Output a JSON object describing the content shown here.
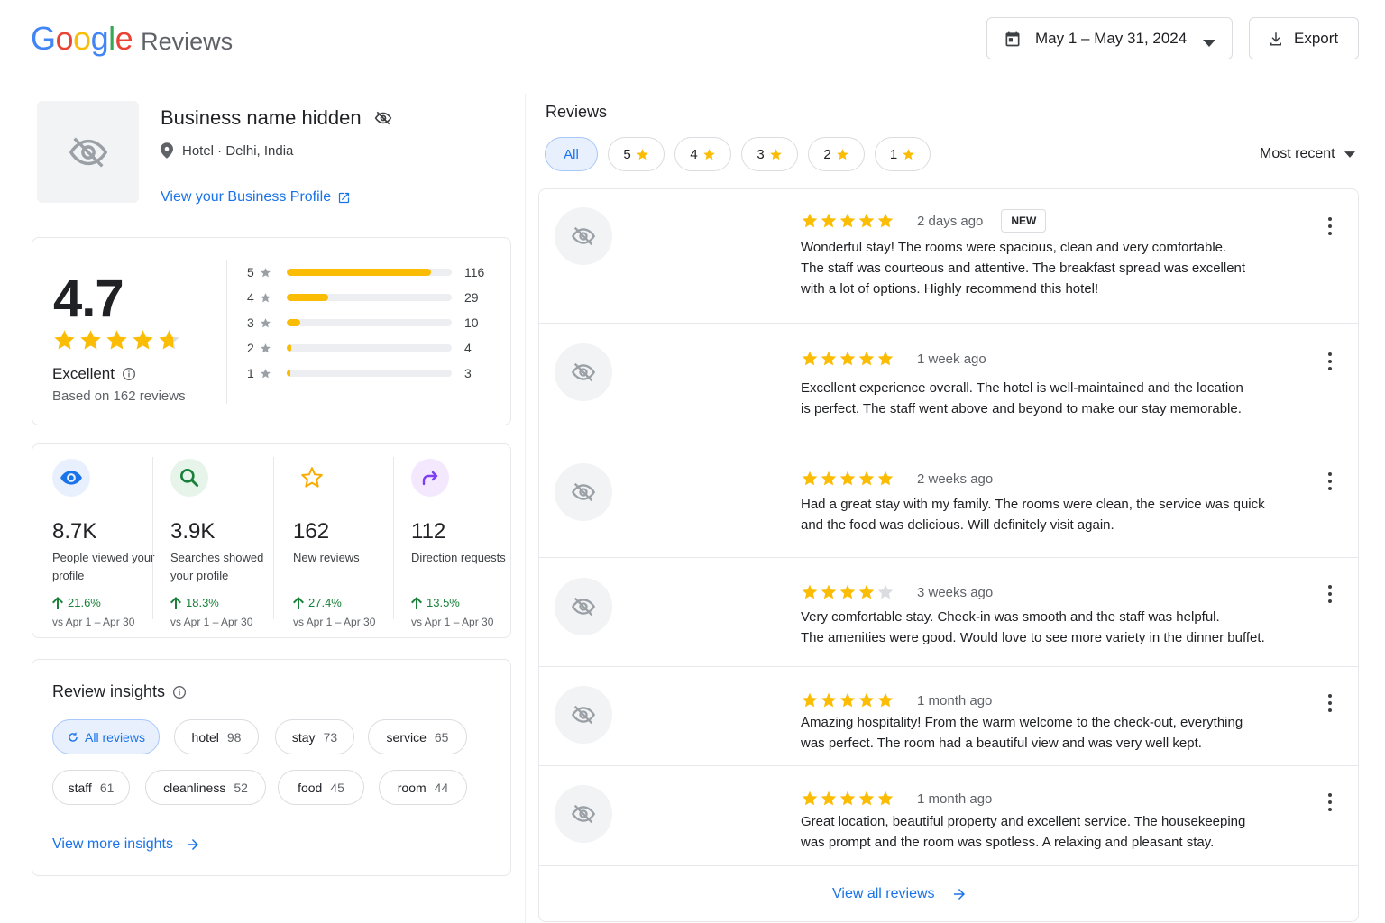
{
  "header": {
    "logo_google": "Google",
    "logo_reviews": "Reviews",
    "date_range": "May 1 – May 31, 2024",
    "export_label": "Export",
    "colors": {
      "blue": "#4285F4",
      "red": "#EA4335",
      "yellow": "#FBBC05",
      "green": "#34A853"
    }
  },
  "business": {
    "name": "Business name hidden",
    "location": "Hotel · Delhi, India",
    "profile_link": "View your Business Profile"
  },
  "rating": {
    "value": "4.7",
    "stars": 4.7,
    "label": "Excellent",
    "based_on": "Based on 162 reviews",
    "distribution": [
      {
        "stars": "5",
        "count": "116",
        "fraction": 0.875
      },
      {
        "stars": "4",
        "count": "29",
        "fraction": 0.25
      },
      {
        "stars": "3",
        "count": "10",
        "fraction": 0.08
      },
      {
        "stars": "2",
        "count": "4",
        "fraction": 0.03
      },
      {
        "stars": "1",
        "count": "3",
        "fraction": 0.02
      }
    ],
    "bar_color": "#fbbc04"
  },
  "stats": [
    {
      "icon": "eye-icon",
      "value": "8.7K",
      "label": "People viewed your profile",
      "change": "21.6%",
      "compare": "vs Apr 1 – Apr 30",
      "color": "#1a73e8",
      "bg": "#e8f0fe"
    },
    {
      "icon": "search-icon",
      "value": "3.9K",
      "label": "Searches showed your profile",
      "change": "18.3%",
      "compare": "vs Apr 1 – Apr 30",
      "color": "#188038",
      "bg": "#e6f4ea"
    },
    {
      "icon": "star-outline-icon",
      "value": "162",
      "label": "New reviews",
      "change": "27.4%",
      "compare": "vs Apr 1 – Apr 30",
      "color": "#f9ab00",
      "bg": "#ffffff"
    },
    {
      "icon": "direction-arrow-icon",
      "value": "112",
      "label": "Direction requests",
      "change": "13.5%",
      "compare": "vs Apr 1 – Apr 30",
      "color": "#7e3ff2",
      "bg": "#f3e8fd"
    }
  ],
  "insights": {
    "title": "Review insights",
    "chips": [
      {
        "label": "All reviews",
        "count": ""
      },
      {
        "label": "hotel",
        "count": "98"
      },
      {
        "label": "stay",
        "count": "73"
      },
      {
        "label": "service",
        "count": "65"
      },
      {
        "label": "staff",
        "count": "61"
      },
      {
        "label": "cleanliness",
        "count": "52"
      },
      {
        "label": "food",
        "count": "45"
      },
      {
        "label": "room",
        "count": "44"
      }
    ],
    "more_link": "View more insights"
  },
  "reviews": {
    "title": "Reviews",
    "filters": [
      "All",
      "5",
      "4",
      "3",
      "2",
      "1"
    ],
    "sort_label": "Most recent",
    "new_badge": "NEW",
    "items": [
      {
        "stars": 5,
        "ago": "2 days ago",
        "is_new": true,
        "lines": [
          "Wonderful stay! The rooms were spacious, clean and very comfortable.",
          "The staff was courteous and attentive. The breakfast spread was excellent",
          "with a lot of options. Highly recommend this hotel!"
        ]
      },
      {
        "stars": 5,
        "ago": "1 week ago",
        "is_new": false,
        "lines": [
          "Excellent experience overall. The hotel is well-maintained and the location",
          "is perfect. The staff went above and beyond to make our stay memorable."
        ]
      },
      {
        "stars": 5,
        "ago": "2 weeks ago",
        "is_new": false,
        "lines": [
          "Had a great stay with my family. The rooms were clean, the service was quick",
          "and the food was delicious. Will definitely visit again."
        ]
      },
      {
        "stars": 4,
        "ago": "3 weeks ago",
        "is_new": false,
        "lines": [
          "Very comfortable stay. Check-in was smooth and the staff was helpful.",
          "The amenities were good. Would love to see more variety in the dinner buffet."
        ]
      },
      {
        "stars": 5,
        "ago": "1 month ago",
        "is_new": false,
        "lines": [
          "Amazing hospitality! From the warm welcome to the check-out, everything",
          "was perfect. The room had a beautiful view and was very well kept."
        ]
      },
      {
        "stars": 5,
        "ago": "1 month ago",
        "is_new": false,
        "lines": [
          "Great location, beautiful property and excellent service. The housekeeping",
          "was prompt and the room was spotless. A relaxing and pleasant stay."
        ]
      }
    ],
    "view_all": "View all reviews"
  }
}
